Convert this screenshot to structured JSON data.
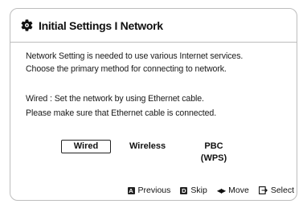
{
  "header": {
    "title": "Initial Settings I Network",
    "icon": "gear-icon"
  },
  "message": {
    "line1": "Network Setting is needed to use various Internet services.",
    "line2": "Choose the primary method for connecting to network.",
    "line3": "Wired : Set the network by using Ethernet cable.",
    "line4": "Please make sure that Ethernet cable is connected."
  },
  "options": [
    {
      "label": "Wired",
      "selected": true
    },
    {
      "label": "Wireless",
      "selected": false
    },
    {
      "label": "PBC (WPS)",
      "selected": false
    }
  ],
  "footer": {
    "previous_key": "A",
    "previous_label": "Previous",
    "skip_key": "D",
    "skip_label": "Skip",
    "move_label": "Move",
    "select_label": "Select"
  }
}
